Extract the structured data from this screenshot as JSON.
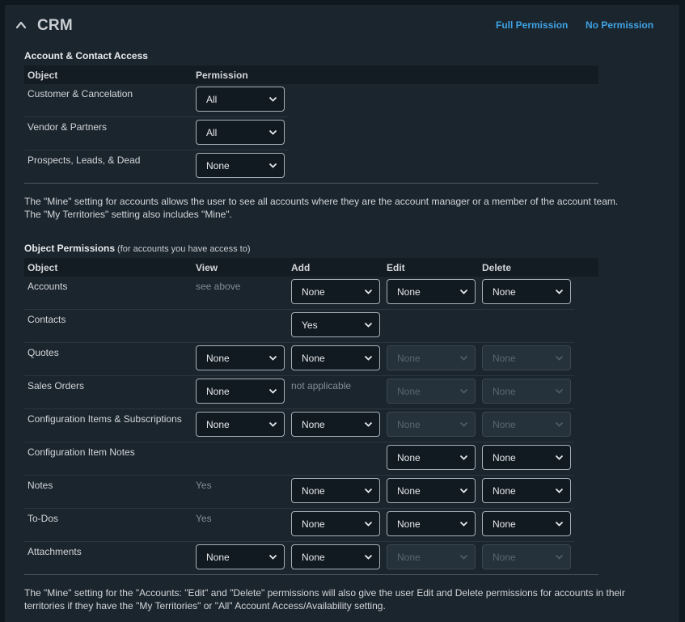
{
  "header": {
    "title": "CRM",
    "full_permission": "Full Permission",
    "no_permission": "No Permission"
  },
  "account_access": {
    "title": "Account & Contact Access",
    "col_object": "Object",
    "col_permission": "Permission",
    "rows": [
      {
        "label": "Customer & Cancelation",
        "value": "All"
      },
      {
        "label": "Vendor & Partners",
        "value": "All"
      },
      {
        "label": "Prospects, Leads, & Dead",
        "value": "None"
      }
    ],
    "note_line1": "The \"Mine\" setting for accounts allows the user to see all accounts where they are the account manager or a member of the account team.",
    "note_line2": "The \"My Territories\" setting also includes \"Mine\"."
  },
  "object_permissions": {
    "title": "Object Permissions",
    "subtitle": "(for accounts you have access to)",
    "columns": {
      "object": "Object",
      "view": "View",
      "add": "Add",
      "edit": "Edit",
      "delete": "Delete"
    },
    "rows": [
      {
        "label": "Accounts",
        "view_text": "see above",
        "add": "None",
        "edit": "None",
        "delete": "None"
      },
      {
        "label": "Contacts",
        "add": "Yes"
      },
      {
        "label": "Quotes",
        "view": "None",
        "add": "None",
        "edit": "None",
        "delete": "None"
      },
      {
        "label": "Sales Orders",
        "view": "None",
        "add_text": "not applicable",
        "edit": "None",
        "delete": "None"
      },
      {
        "label": "Configuration Items & Subscriptions",
        "view": "None",
        "add": "None",
        "edit": "None",
        "delete": "None"
      },
      {
        "label": "Configuration Item Notes",
        "edit": "None",
        "delete": "None"
      },
      {
        "label": "Notes",
        "view_text": "Yes",
        "add": "None",
        "edit": "None",
        "delete": "None"
      },
      {
        "label": "To-Dos",
        "view_text": "Yes",
        "add": "None",
        "edit": "None",
        "delete": "None"
      },
      {
        "label": "Attachments",
        "view": "None",
        "add": "None",
        "edit": "None",
        "delete": "None"
      }
    ],
    "note_line1": "The \"Mine\" setting for the \"Accounts: \"Edit\" and \"Delete\" permissions will also give the user Edit and Delete permissions for accounts in their",
    "note_line2": "territories if they have the \"My Territories\" or \"All\" Account Access/Availability setting."
  },
  "colors": {
    "background": "#10181f",
    "panel": "#1b252d",
    "link": "#3fa3e6",
    "table_header": "#141c23"
  }
}
